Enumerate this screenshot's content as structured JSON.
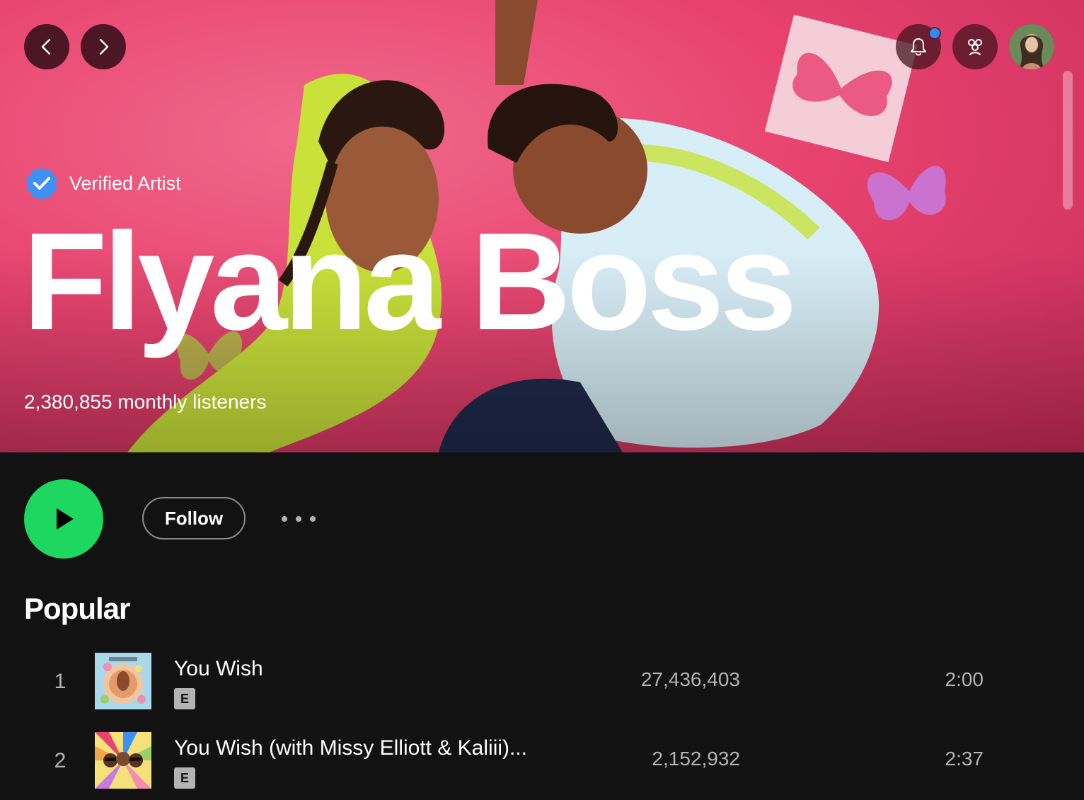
{
  "window": {
    "title": "Flyana Boss"
  },
  "nav": {
    "back_icon": "chevron-left-icon",
    "forward_icon": "chevron-right-icon"
  },
  "topbar": {
    "notifications_icon": "bell-icon",
    "friends_icon": "friends-icon",
    "has_notification": true,
    "notification_dot_color": "#2e8bf0"
  },
  "artist": {
    "verified_label": "Verified Artist",
    "name": "Flyana Boss",
    "monthly_listeners": "2,380,855 monthly listeners"
  },
  "actions": {
    "follow_label": "Follow",
    "play_color": "#1ed760"
  },
  "popular": {
    "title": "Popular",
    "tracks": [
      {
        "rank": "1",
        "title": "You Wish",
        "explicit": "E",
        "plays": "27,436,403",
        "duration": "2:00"
      },
      {
        "rank": "2",
        "title": "You Wish (with Missy Elliott & Kaliii)...",
        "explicit": "E",
        "plays": "2,152,932",
        "duration": "2:37"
      }
    ]
  },
  "colors": {
    "hero_accent": "#e8436f",
    "background": "#121212"
  }
}
